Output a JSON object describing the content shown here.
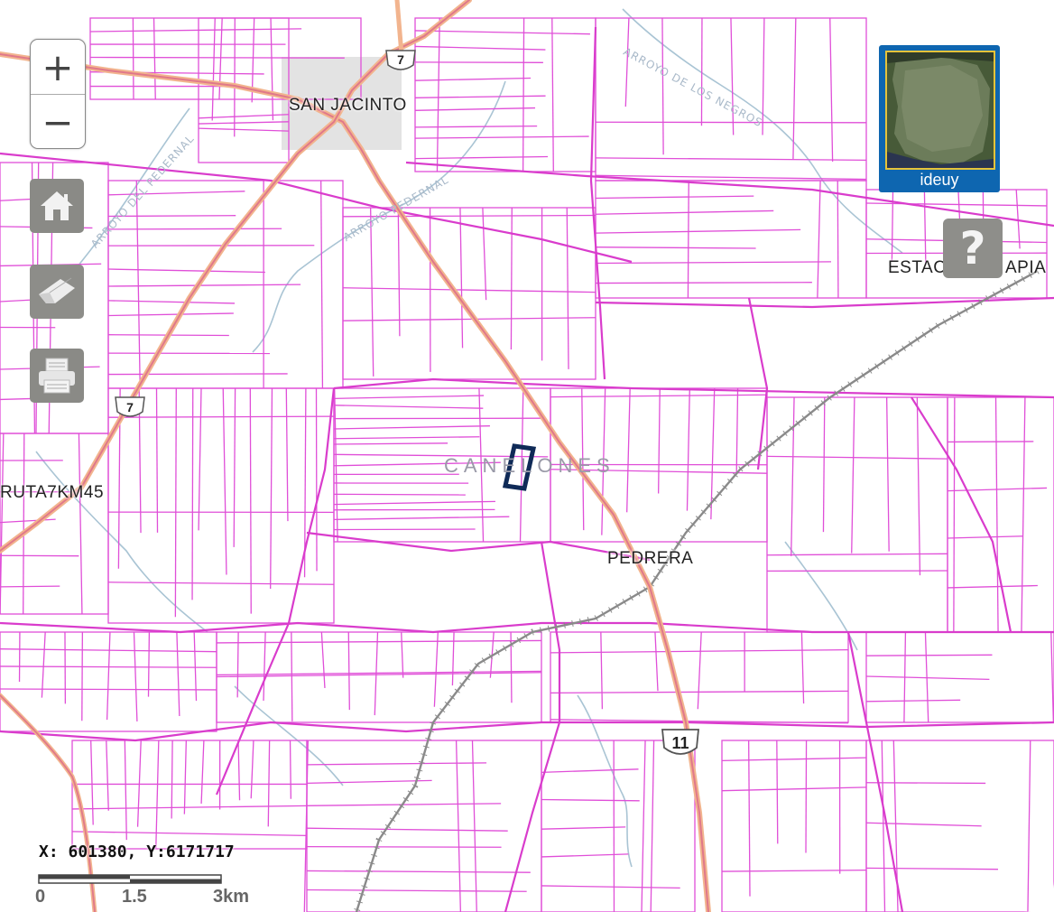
{
  "map": {
    "place_labels": [
      "SAN JACINTO",
      "ESTAC",
      "APIA",
      "RUTA7KM45",
      "PEDRERA"
    ],
    "department_label": "CANELONES",
    "stream_labels": [
      "ARROYO DE LOS NEGROS",
      "ARROYO DEL PEDERNAL",
      "ARROYO PEDERNAL"
    ],
    "route_shields": [
      "7",
      "7",
      "11"
    ],
    "colors": {
      "parcels": "#e04fd8",
      "roads": "#f0a070",
      "road_core": "#e08a8a",
      "railway": "#888888",
      "streams": "#a9c4d4",
      "urban_area": "#e3e3e3",
      "selected_parcel": "#0f2a57"
    }
  },
  "controls": {
    "zoom_in": "+",
    "zoom_out": "−",
    "home_icon": "home-icon",
    "eraser_icon": "eraser-icon",
    "print_icon": "printer-icon",
    "help": "?"
  },
  "basemap_switcher": {
    "label": "ideuy"
  },
  "coordinates": "X: 601380, Y:6171717",
  "scale_bar": {
    "labels": [
      "0",
      "1.5",
      "3km"
    ]
  }
}
